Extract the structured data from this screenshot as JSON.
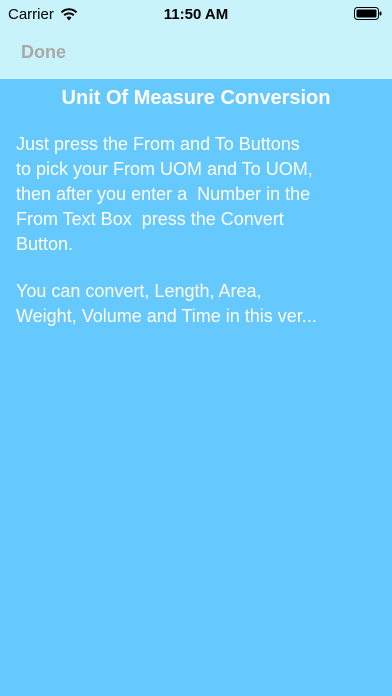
{
  "status_bar": {
    "carrier": "Carrier",
    "time": "11:50 AM",
    "wifi_icon": "wifi-icon",
    "battery_icon": "battery-icon"
  },
  "nav": {
    "done_label": "Done"
  },
  "content": {
    "title": "Unit Of Measure Conversion",
    "paragraph1": "Just press the From and To Buttons\nto pick your From UOM and To UOM,\nthen after you enter a  Number in the\nFrom Text Box  press the Convert\nButton.",
    "paragraph2": "You can convert, Length, Area,\nWeight, Volume and Time in this ver..."
  },
  "colors": {
    "background": "#66c9fd",
    "bars": "#c9f3fb",
    "done_text": "#a9a9a9",
    "text": "#ffffff"
  }
}
